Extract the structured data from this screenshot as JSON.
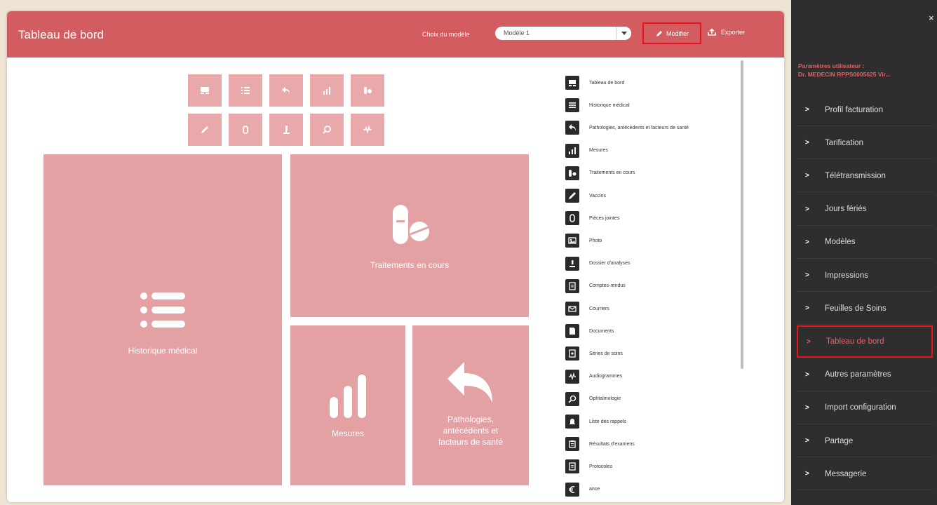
{
  "header": {
    "title": "Tableau de bord",
    "model_label": "Choix du modèle",
    "model_value": "Modèle 1",
    "edit_label": "Modifier",
    "export_label": "Exporter"
  },
  "widgets": {
    "traitements": "Traitements en cours",
    "historique": "Historique médical",
    "mesures": "Mesures",
    "pathologies_line1": "Pathologies,",
    "pathologies_line2": "antécédents et",
    "pathologies_line3": "facteurs de santé"
  },
  "widget_list": [
    {
      "label": "Tableau de bord",
      "icon": "dashboard-icon"
    },
    {
      "label": "Historique médical",
      "icon": "list-icon"
    },
    {
      "label": "Pathologies, antécédents et facteurs de santé",
      "icon": "reply-arrow-icon"
    },
    {
      "label": "Mesures",
      "icon": "bar-chart-icon"
    },
    {
      "label": "Traitements en cours",
      "icon": "pill-icon"
    },
    {
      "label": "Vaccins",
      "icon": "syringe-icon"
    },
    {
      "label": "Pièces jointes",
      "icon": "paperclip-icon"
    },
    {
      "label": "Photo",
      "icon": "photo-icon"
    },
    {
      "label": "Dossier d'analyses",
      "icon": "microscope-icon"
    },
    {
      "label": "Comptes-rendus",
      "icon": "report-icon"
    },
    {
      "label": "Courriers",
      "icon": "envelope-icon"
    },
    {
      "label": "Documents",
      "icon": "document-icon"
    },
    {
      "label": "Séries de soins",
      "icon": "care-series-icon"
    },
    {
      "label": "Audiogrammes",
      "icon": "audiogram-icon"
    },
    {
      "label": "Ophtalmologie",
      "icon": "eye-icon"
    },
    {
      "label": "Liste des rappels",
      "icon": "bell-icon"
    },
    {
      "label": "Résultats d'examens",
      "icon": "clipboard-icon"
    },
    {
      "label": "Protocoles",
      "icon": "protocol-icon"
    },
    {
      "label": "ance",
      "icon": "euro-icon"
    }
  ],
  "panel": {
    "close_label": "×",
    "user_title": "Paramètres utilisateur :",
    "user_name": "Dr. MEDECIN RPPS0005625 Vir...",
    "chevron": ">",
    "items": [
      "Profil facturation",
      "Tarification",
      "Télétransmission",
      "Jours fériés",
      "Modèles",
      "Impressions",
      "Feuilles de Soins",
      "Tableau de bord",
      "Autres paramètres",
      "Import configuration",
      "Partage",
      "Messagerie"
    ],
    "active_index": 7
  },
  "colors": {
    "header": "#d35c61",
    "tile": "#e4a1a4",
    "panel": "#2e2e2e",
    "highlight": "#e8141c",
    "panel_accent": "#e06066"
  }
}
